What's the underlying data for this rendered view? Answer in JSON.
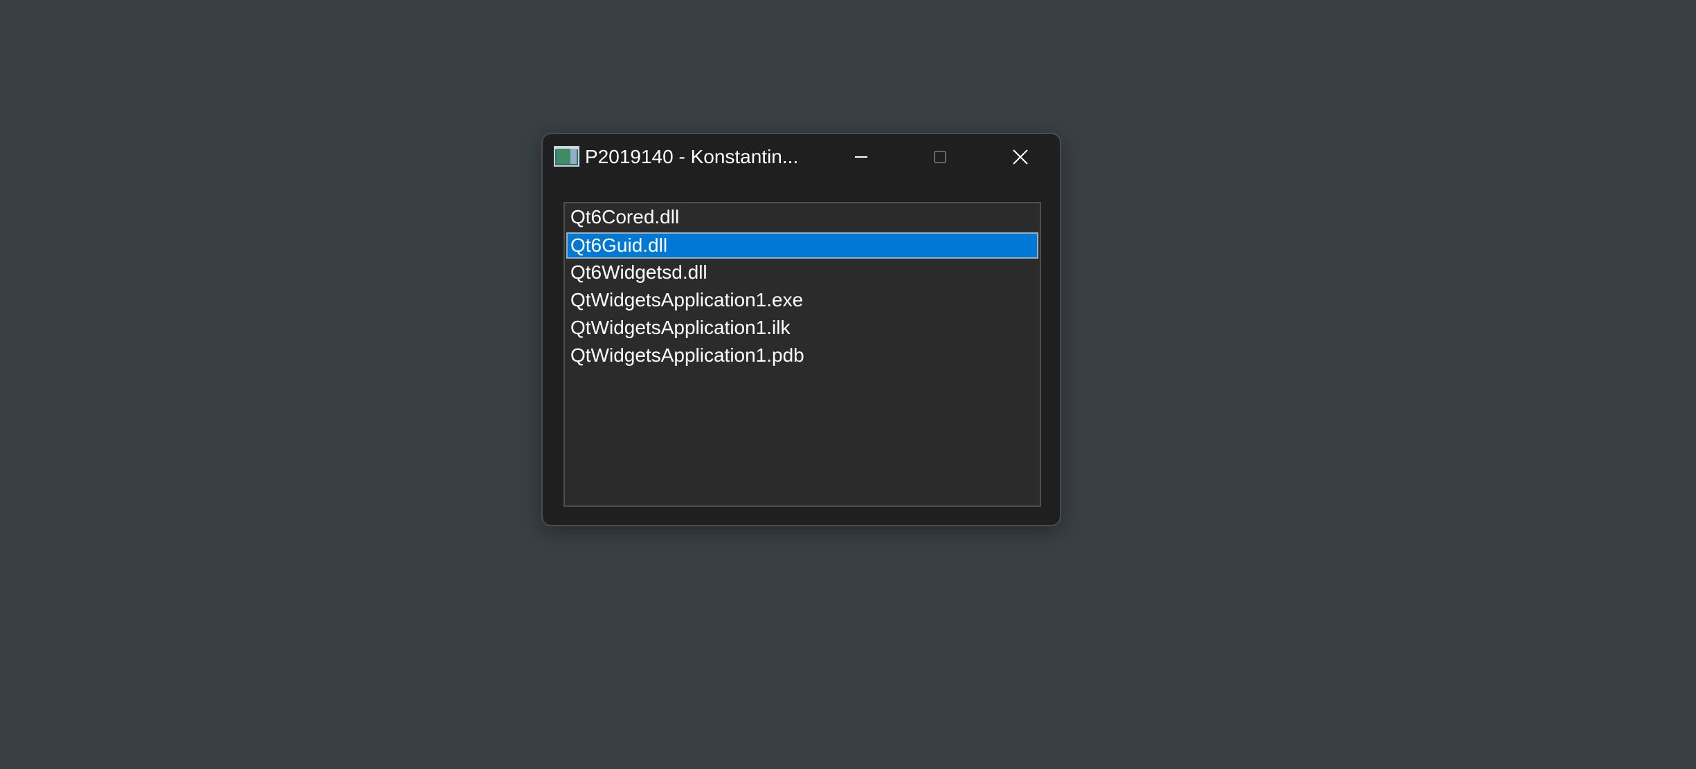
{
  "window": {
    "title": "P2019140 - Konstantin...",
    "icon": "application-window-icon",
    "controls": {
      "minimize": "minimize-icon",
      "maximize": "maximize-icon",
      "close": "close-icon"
    }
  },
  "list": {
    "items": [
      {
        "label": "Qt6Cored.dll",
        "selected": false
      },
      {
        "label": "Qt6Guid.dll",
        "selected": true
      },
      {
        "label": "Qt6Widgetsd.dll",
        "selected": false
      },
      {
        "label": "QtWidgetsApplication1.exe",
        "selected": false
      },
      {
        "label": "QtWidgetsApplication1.ilk",
        "selected": false
      },
      {
        "label": "QtWidgetsApplication1.pdb",
        "selected": false
      }
    ]
  },
  "colors": {
    "desktop": "#394044",
    "window": "#1f1f1f",
    "list_background": "#2b2b2b",
    "selection": "#0078d4",
    "text": "#ffffff"
  }
}
